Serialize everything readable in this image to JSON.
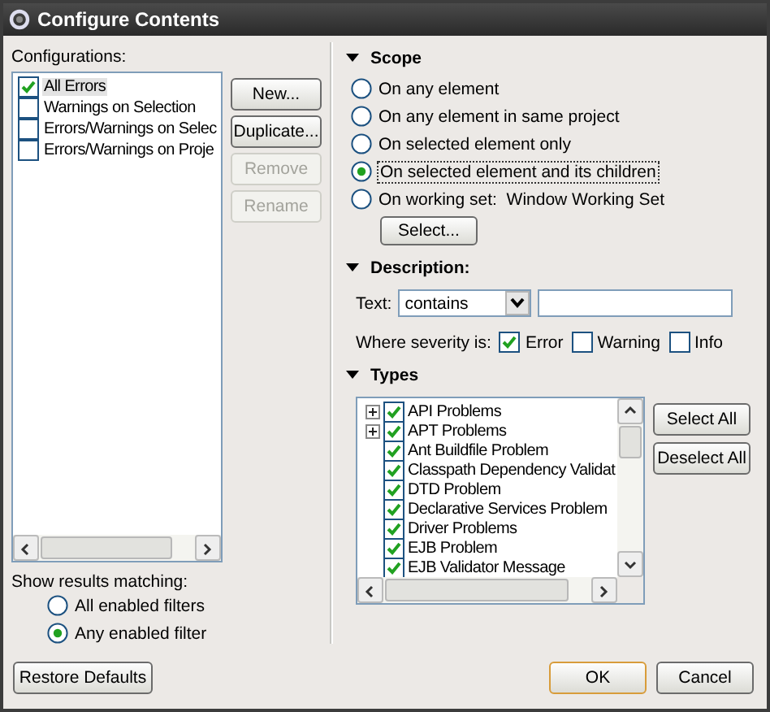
{
  "window": {
    "title": "Configure Contents"
  },
  "configurations": {
    "label": "Configurations:",
    "items": [
      {
        "label": "All Errors",
        "checked": true,
        "selected": true
      },
      {
        "label": "Warnings on Selection",
        "checked": false,
        "selected": false
      },
      {
        "label": "Errors/Warnings on Selec",
        "checked": false,
        "selected": false
      },
      {
        "label": "Errors/Warnings on Proje",
        "checked": false,
        "selected": false
      }
    ]
  },
  "config_buttons": [
    {
      "label": "New...",
      "disabled": false
    },
    {
      "label": "Duplicate...",
      "disabled": false
    },
    {
      "label": "Remove",
      "disabled": true
    },
    {
      "label": "Rename",
      "disabled": true
    }
  ],
  "show_results": {
    "label": "Show results matching:",
    "options": [
      {
        "label": "All enabled filters",
        "selected": false
      },
      {
        "label": "Any enabled filter",
        "selected": true
      }
    ]
  },
  "scope": {
    "title": "Scope",
    "expanded": true,
    "options": [
      {
        "label": "On any element",
        "selected": false
      },
      {
        "label": "On any element in same project",
        "selected": false
      },
      {
        "label": "On selected element only",
        "selected": false
      },
      {
        "label": "On selected element and its children",
        "selected": true
      },
      {
        "label": "On working set:  Window Working Set",
        "selected": false
      }
    ],
    "select_button": "Select..."
  },
  "description": {
    "title": "Description:",
    "expanded": true,
    "text_label": "Text:",
    "match_mode": "contains",
    "severity_label": "Where severity is:",
    "severities": [
      {
        "label": "Error",
        "checked": true
      },
      {
        "label": "Warning",
        "checked": false
      },
      {
        "label": "Info",
        "checked": false
      }
    ]
  },
  "types": {
    "title": "Types",
    "expanded": true,
    "items": [
      {
        "label": "API Problems",
        "checked": true,
        "expandable": true
      },
      {
        "label": "APT Problems",
        "checked": true,
        "expandable": true
      },
      {
        "label": "Ant Buildfile Problem",
        "checked": true,
        "expandable": false
      },
      {
        "label": "Classpath Dependency Validat",
        "checked": true,
        "expandable": false
      },
      {
        "label": "DTD Problem",
        "checked": true,
        "expandable": false
      },
      {
        "label": "Declarative Services Problem",
        "checked": true,
        "expandable": false
      },
      {
        "label": "Driver Problems",
        "checked": true,
        "expandable": false
      },
      {
        "label": "EJB Problem",
        "checked": true,
        "expandable": false
      },
      {
        "label": "EJB Validator Message",
        "checked": true,
        "expandable": false
      }
    ],
    "buttons": [
      "Select All",
      "Deselect All"
    ]
  },
  "footer": {
    "restore_button": "Restore Defaults",
    "ok_button": "OK",
    "cancel_button": "Cancel"
  }
}
